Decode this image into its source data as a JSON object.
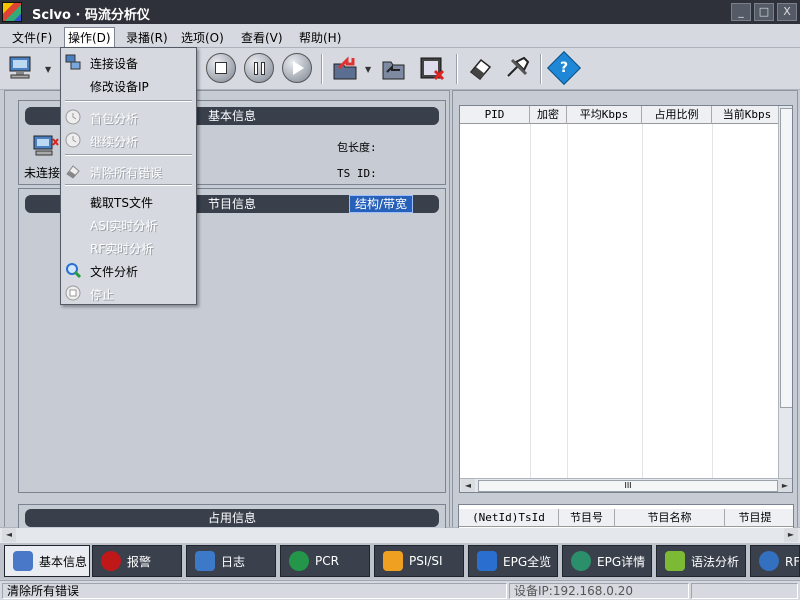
{
  "window": {
    "title": "Sclvo · 码流分析仪",
    "controls": {
      "minimize": "_",
      "maximize": "□",
      "close": "X"
    }
  },
  "menu": {
    "items": [
      "文件(F)",
      "操作(D)",
      "录播(R)",
      "选项(O)",
      "查看(V)",
      "帮助(H)"
    ],
    "active": "操作(D)"
  },
  "toolbar": {
    "buttons": [
      {
        "name": "connect",
        "icon": "computer-icon"
      },
      {
        "name": "stop",
        "icon": "stop-icon"
      },
      {
        "name": "pause",
        "icon": "pause-icon"
      },
      {
        "name": "play",
        "icon": "play-icon"
      },
      {
        "name": "import",
        "icon": "folder-arrow-icon"
      },
      {
        "name": "open",
        "icon": "folder-open-icon"
      },
      {
        "name": "record",
        "icon": "film-icon"
      },
      {
        "name": "erase",
        "icon": "eraser-icon"
      },
      {
        "name": "tools",
        "icon": "wrench-icon"
      },
      {
        "name": "help",
        "icon": "help-icon",
        "label": "?"
      }
    ]
  },
  "dropdown": {
    "items": [
      {
        "label": "连接设备",
        "enabled": true,
        "icon": "network-icon"
      },
      {
        "label": "修改设备IP",
        "enabled": true,
        "icon": ""
      },
      {
        "separator": true
      },
      {
        "label": "首包分析",
        "enabled": false,
        "icon": "clock-icon"
      },
      {
        "label": "继续分析",
        "enabled": false,
        "icon": "clock-icon"
      },
      {
        "separator": true
      },
      {
        "label": "清除所有错误",
        "enabled": false,
        "icon": "eraser-icon"
      },
      {
        "separator": true
      },
      {
        "label": "截取TS文件",
        "enabled": true,
        "icon": ""
      },
      {
        "label": "ASI实时分析",
        "enabled": false,
        "icon": ""
      },
      {
        "label": "RF实时分析",
        "enabled": false,
        "icon": ""
      },
      {
        "label": "文件分析",
        "enabled": true,
        "icon": "magnifier-icon"
      },
      {
        "label": "停止",
        "enabled": false,
        "icon": "stop-icon"
      }
    ]
  },
  "panels": {
    "basic_info": {
      "header": "基本信息",
      "status": "未连接",
      "fields": [
        {
          "label": "包长度:",
          "value": ""
        },
        {
          "label": "TS ID:",
          "value": ""
        }
      ]
    },
    "program_info": {
      "header": "节目信息",
      "button": "结构/带宽"
    },
    "usage_info": {
      "header": "占用信息"
    },
    "pid_table": {
      "columns": [
        "PID",
        "加密",
        "平均Kbps",
        "占用比例",
        "当前Kbps"
      ]
    },
    "program_table": {
      "columns": [
        "(NetId)TsId",
        "节目号",
        "节目名称",
        "节目提"
      ]
    },
    "scrollbar": {
      "h_arrow_left": "◄",
      "h_arrow_right": "►",
      "grip": "III"
    }
  },
  "tabs": [
    {
      "label": "基本信息",
      "active": true,
      "icon": "pen-icon",
      "color": "#4a78c8"
    },
    {
      "label": "报警",
      "active": false,
      "icon": "alarm-icon",
      "color": "#c01818"
    },
    {
      "label": "日志",
      "active": false,
      "icon": "log-icon",
      "color": "#3c79c8"
    },
    {
      "label": "PCR",
      "active": false,
      "icon": "clock-icon",
      "color": "#24964a"
    },
    {
      "label": "PSI/SI",
      "active": false,
      "icon": "tag-icon",
      "color": "#f0a020"
    },
    {
      "label": "EPG全览",
      "active": false,
      "icon": "epg-icon",
      "color": "#2a6fd0"
    },
    {
      "label": "EPG详情",
      "active": false,
      "icon": "globe-icon",
      "color": "#2a8f6a"
    },
    {
      "label": "语法分析",
      "active": false,
      "icon": "grid-icon",
      "color": "#7cba36"
    },
    {
      "label": "RF分",
      "active": false,
      "icon": "globe-icon",
      "color": "#3470c0"
    }
  ],
  "statusbar": {
    "message": "清除所有错误",
    "device_ip": "设备IP:192.168.0.20"
  }
}
